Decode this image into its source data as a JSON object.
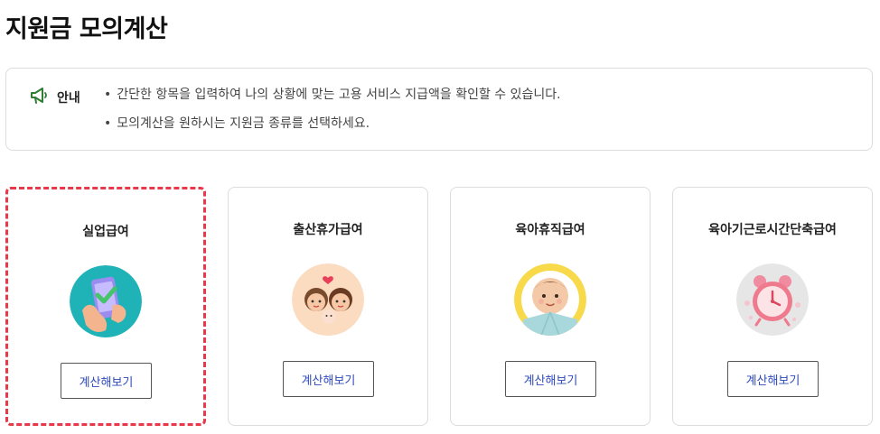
{
  "page": {
    "title": "지원금 모의계산"
  },
  "notice": {
    "icon": "megaphone-icon",
    "label": "안내",
    "items": [
      "간단한 항목을 입력하여 나의 상황에 맞는 고용 서비스 지급액을 확인할 수 있습니다.",
      "모의계산을 원하시는 지원금 종류를 선택하세요."
    ]
  },
  "cards": [
    {
      "title": "실업급여",
      "icon": "phone-check-icon",
      "button": "계산해보기",
      "selected": true
    },
    {
      "title": "출산휴가급여",
      "icon": "family-icon",
      "button": "계산해보기",
      "selected": false
    },
    {
      "title": "육아휴직급여",
      "icon": "baby-icon",
      "button": "계산해보기",
      "selected": false
    },
    {
      "title": "육아기근로시간단축급여",
      "icon": "alarm-clock-icon",
      "button": "계산해보기",
      "selected": false
    }
  ],
  "colors": {
    "selected_border": "#e8394a",
    "button_text": "#2f49b8",
    "notice_icon": "#2e7d32"
  }
}
